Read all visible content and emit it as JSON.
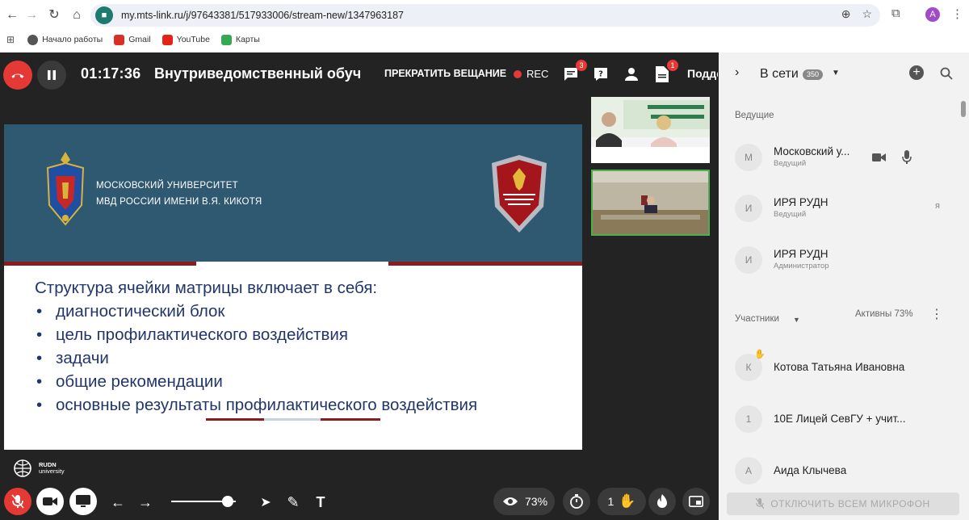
{
  "browser": {
    "url": "my.mts-link.ru/j/97643381/517933006/stream-new/1347963187",
    "profile_initial": "A",
    "bookmarks": [
      {
        "label": "Начало работы",
        "color": "#555555"
      },
      {
        "label": "Gmail",
        "color": "#d93025"
      },
      {
        "label": "YouTube",
        "color": "#e62117"
      },
      {
        "label": "Карты",
        "color": "#34a853"
      }
    ]
  },
  "topbar": {
    "timer": "01:17:36",
    "title": "Внутриведомственный обучающий",
    "stop_label": "ПРЕКРАТИТЬ ВЕЩАНИЕ",
    "rec_label": "REC",
    "chat_badge": "3",
    "docs_badge": "1",
    "more_label": "Подде"
  },
  "slide": {
    "university_line1": "МОСКОВСКИЙ УНИВЕРСИТЕТ",
    "university_line2": "МВД РОССИИ ИМЕНИ В.Я. КИКОТЯ",
    "heading": "Структура ячейки матрицы включает в себя:",
    "bullets": [
      "диагностический блок",
      "цель профилактического воздействия",
      "задачи",
      "общие рекомендации",
      "основные результаты профилактического воздействия"
    ],
    "head_color": "#2f5871",
    "accent_color": "#8c1b20"
  },
  "footer_logo": {
    "line1": "RUDN",
    "line2": "university"
  },
  "bottombar": {
    "zoom_level": 0.88,
    "attention_percent": "73%",
    "hands_count": "1"
  },
  "sidebar": {
    "title": "В сети",
    "online_count": "350",
    "hosts_label": "Ведущие",
    "hosts": [
      {
        "initial": "М",
        "name": "Московский у...",
        "role": "Ведущий"
      },
      {
        "initial": "И",
        "name": "ИРЯ РУДН",
        "role": "Ведущий",
        "tag": "я"
      },
      {
        "initial": "И",
        "name": "ИРЯ РУДН",
        "role": "Администратор"
      }
    ],
    "participants_label": "Участники",
    "active_label": "Активны 73%",
    "participants": [
      {
        "initial": "К",
        "name": "Котова Татьяна Ивановна"
      },
      {
        "initial": "1",
        "name": "10Е Лицей СевГУ + учит..."
      },
      {
        "initial": "А",
        "name": "Аида Клычева"
      }
    ],
    "mute_all_label": "ОТКЛЮЧИТЬ ВСЕМ МИКРОФОН"
  }
}
